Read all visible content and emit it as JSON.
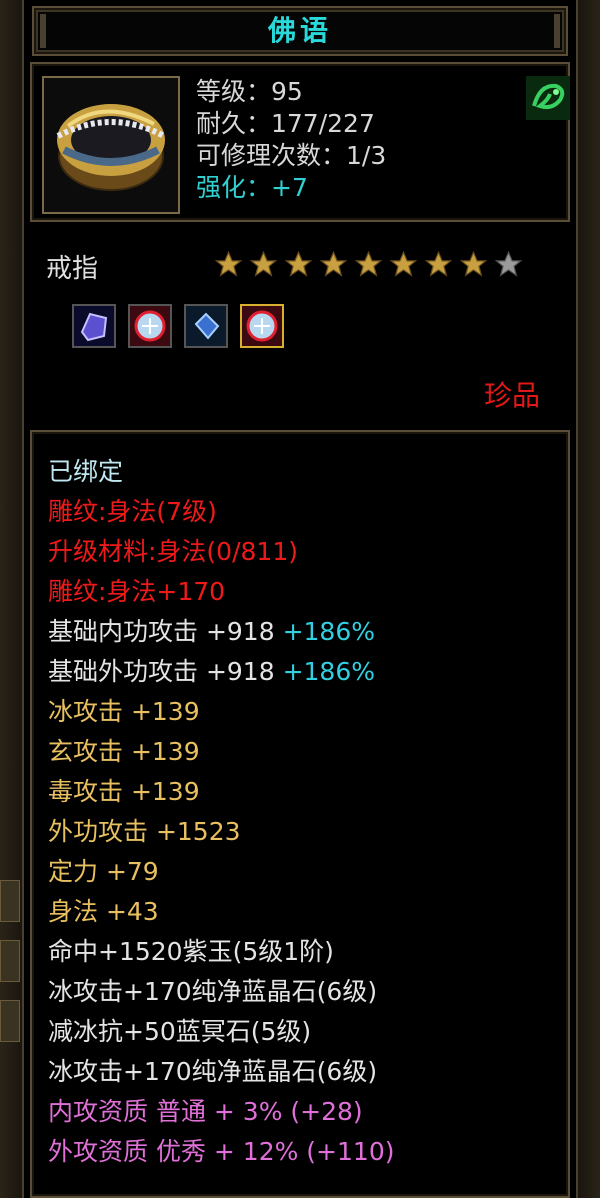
{
  "title": "佛语",
  "item": {
    "level_label": "等级：95",
    "durability_label": "耐久：177/227",
    "repairs_label": "可修理次数：1/3",
    "enhance_label": "强化：+7",
    "type": "戒指",
    "stars_total": 9,
    "stars_filled": 8,
    "rarity": "珍品"
  },
  "gems": [
    {
      "icon": "purple-gem-icon",
      "selected": false
    },
    {
      "icon": "red-crystal-gem-icon",
      "selected": false
    },
    {
      "icon": "blue-crystal-gem-icon",
      "selected": false
    },
    {
      "icon": "red-crystal-gem-icon",
      "selected": true
    }
  ],
  "attributes": {
    "bound": "已绑定",
    "engrave_1": "雕纹:身法(7级)",
    "upgrade_material": "升级材料:身法(0/811)",
    "engrave_2": "雕纹:身法+170",
    "base_inner_atk": "基础内功攻击 +918",
    "base_inner_atk_pct": "+186%",
    "base_outer_atk": "基础外功攻击 +918",
    "base_outer_atk_pct": "+186%",
    "ice_atk": "冰攻击 +139",
    "xuan_atk": "玄攻击 +139",
    "poison_atk": "毒攻击 +139",
    "outer_atk": "外功攻击 +1523",
    "focus": "定力 +79",
    "agility": "身法 +43",
    "socket_1": "命中+1520紫玉(5级1阶)",
    "socket_2": "冰攻击+170纯净蓝晶石(6级)",
    "socket_3": "减冰抗+50蓝冥石(5级)",
    "socket_4": "冰攻击+170纯净蓝晶石(6级)",
    "inner_quality": "内攻资质 普通 + 3% (+28)",
    "outer_quality": "外攻资质 优秀 + 12% (+110)"
  },
  "colors": {
    "title": "#29d8d8",
    "red": "#ee1a1a",
    "orange": "#e8c060",
    "cyan": "#30d0e0",
    "pink": "#e070d8"
  }
}
